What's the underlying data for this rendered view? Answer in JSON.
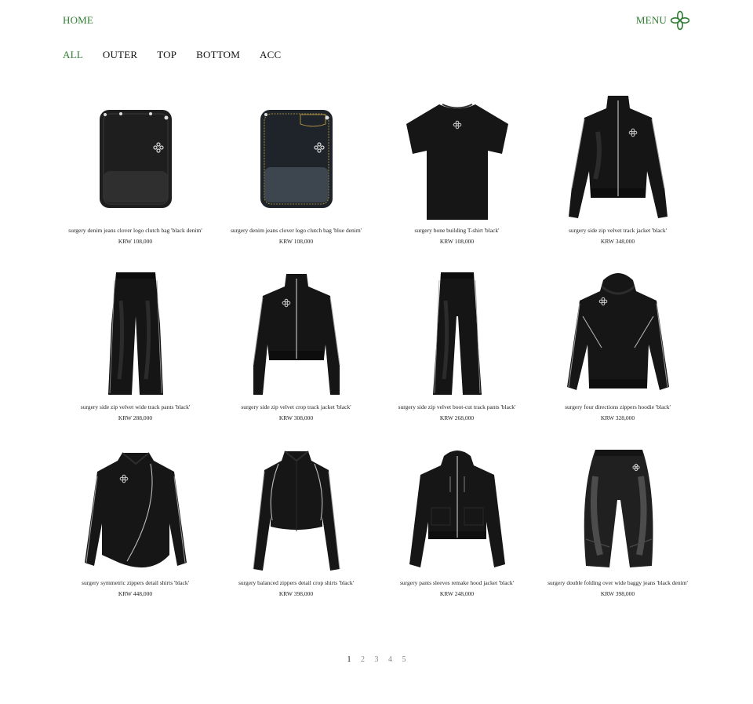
{
  "header": {
    "home_label": "HOME",
    "menu_label": "MENU"
  },
  "categories": [
    {
      "label": "ALL",
      "active": true
    },
    {
      "label": "OUTER",
      "active": false
    },
    {
      "label": "TOP",
      "active": false
    },
    {
      "label": "BOTTOM",
      "active": false
    },
    {
      "label": "ACC",
      "active": false
    }
  ],
  "products": [
    {
      "name": "surgery denim jeans clover logo clutch bag 'black denim'",
      "price": "KRW 108,000",
      "icon": "clutch-bag-black-denim"
    },
    {
      "name": "surgery denim jeans clover logo clutch bag 'blue denim'",
      "price": "KRW 108,000",
      "icon": "clutch-bag-blue-denim"
    },
    {
      "name": "surgery bone building T-shirt 'black'",
      "price": "KRW 108,000",
      "icon": "t-shirt"
    },
    {
      "name": "surgery side zip velvet track jacket 'black'",
      "price": "KRW 348,000",
      "icon": "track-jacket"
    },
    {
      "name": "surgery side zip velvet wide track pants 'black'",
      "price": "KRW 288,000",
      "icon": "wide-pants"
    },
    {
      "name": "surgery side zip velvet crop track jacket 'black'",
      "price": "KRW 308,000",
      "icon": "crop-jacket"
    },
    {
      "name": "surgery side zip velvet boot-cut track pants 'black'",
      "price": "KRW 268,000",
      "icon": "bootcut-pants"
    },
    {
      "name": "surgery four directions zippers hoodie 'black'",
      "price": "KRW 328,000",
      "icon": "hoodie"
    },
    {
      "name": "surgery symmetric zippers detail shirts 'black'",
      "price": "KRW 448,000",
      "icon": "shirt"
    },
    {
      "name": "surgery balanced zippers detail crop shirts 'black'",
      "price": "KRW 398,000",
      "icon": "crop-shirt"
    },
    {
      "name": "surgery pants sleeves remake hood jacket 'black'",
      "price": "KRW 248,000",
      "icon": "hood-jacket"
    },
    {
      "name": "surgery double folding over wide baggy jeans 'black denim'",
      "price": "KRW 398,000",
      "icon": "baggy-jeans"
    }
  ],
  "pagination": {
    "pages": [
      "1",
      "2",
      "3",
      "4",
      "5"
    ],
    "current": "1"
  },
  "colors": {
    "accent": "#2f7d32",
    "text": "#111111",
    "garment": "#161616"
  }
}
